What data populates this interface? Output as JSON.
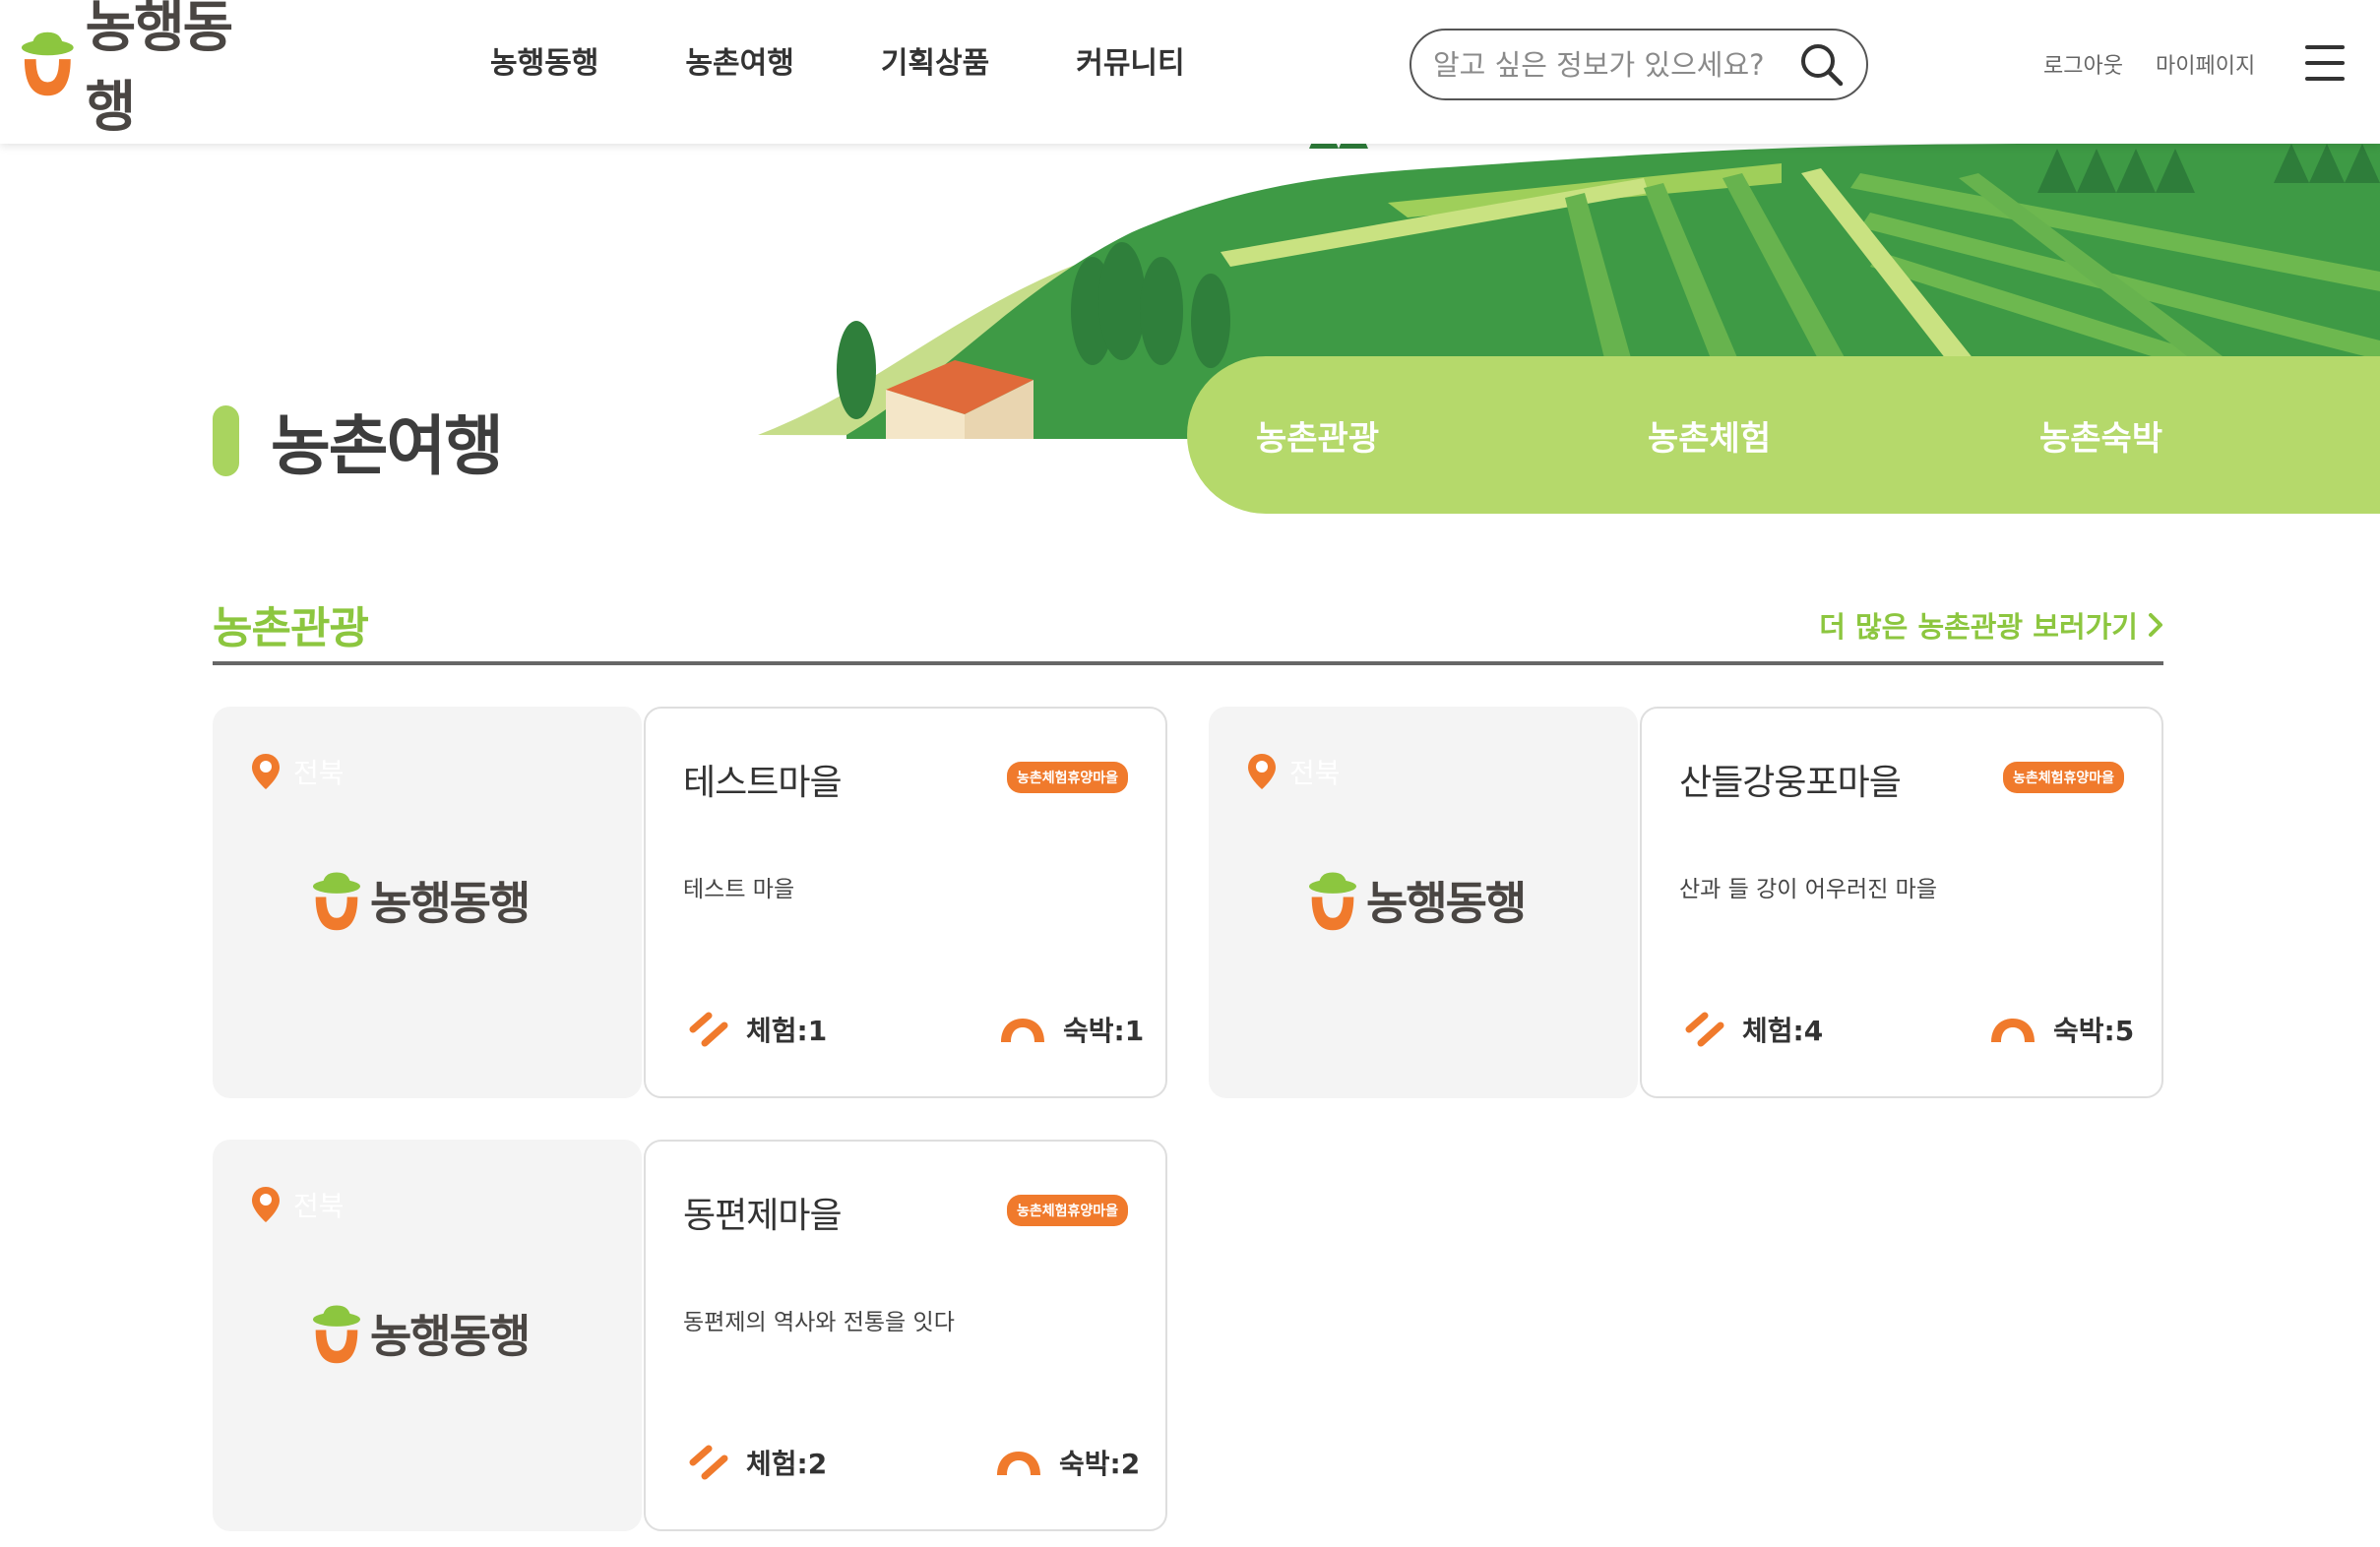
{
  "brand": {
    "name": "농행동행"
  },
  "nav": {
    "items": [
      "농행동행",
      "농촌여행",
      "기획상품",
      "커뮤니티"
    ]
  },
  "search": {
    "placeholder": "알고 싶은 정보가 있으세요?"
  },
  "util": {
    "logout": "로그아웃",
    "mypage": "마이페이지"
  },
  "hero": {
    "title": "농촌여행",
    "tabs": [
      "농촌관광",
      "농촌체험",
      "농촌숙박"
    ]
  },
  "section": {
    "title": "농촌관광",
    "more": "더 많은 농촌관광 보러가기"
  },
  "cards": [
    {
      "region": "전북",
      "name": "테스트마을",
      "badge": "농촌체험휴양마을",
      "desc": "테스트 마을",
      "experience": "체험:1",
      "stay": "숙박:1"
    },
    {
      "region": "전북",
      "name": "산들강웅포마을",
      "badge": "농촌체험휴양마을",
      "desc": "산과 들 강이 어우러진 마을",
      "experience": "체험:4",
      "stay": "숙박:5"
    },
    {
      "region": "전북",
      "name": "동편제마을",
      "badge": "농촌체험휴양마을",
      "desc": "동편제의 역사와 전통을 잇다",
      "experience": "체험:2",
      "stay": "숙박:2"
    }
  ],
  "colors": {
    "accent_green": "#8cc63f",
    "tab_green": "#b5d96b",
    "accent_orange": "#f07a2c",
    "logo_brown": "#4a4643"
  },
  "icons": [
    "search-icon",
    "menu-icon",
    "location-pin-icon",
    "experience-icon",
    "stay-icon",
    "chevron-right-icon"
  ]
}
